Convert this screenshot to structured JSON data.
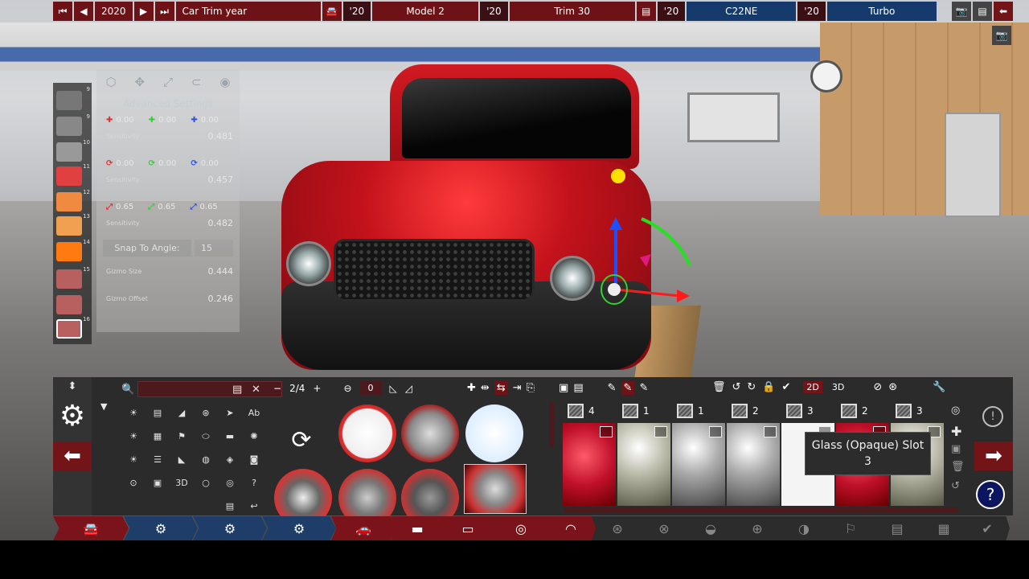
{
  "topbar": {
    "year": "2020",
    "year_label": "Car Trim year",
    "model_year": "'20",
    "model_name": "Model 2",
    "trim_year": "'20",
    "trim_name": "Trim 30",
    "engine_year": "'20",
    "engine_name": "C22NE",
    "variant_year": "'20",
    "variant_name": "Turbo"
  },
  "thumb_numbers": [
    "9",
    "9",
    "10",
    "11",
    "12",
    "13",
    "14",
    "15",
    "16"
  ],
  "advanced": {
    "title": "Advanced Settings",
    "move_x": "0.00",
    "move_y": "0.00",
    "move_z": "0.00",
    "move_sensitivity_label": "Sensitivity",
    "move_sensitivity": "0.481",
    "rot_x": "0.00",
    "rot_y": "0.00",
    "rot_z": "0.00",
    "rot_sensitivity_label": "Sensitivity",
    "rot_sensitivity": "0.457",
    "scale_x": "0.65",
    "scale_y": "0.65",
    "scale_z": "0.65",
    "scale_sensitivity_label": "Sensitivity",
    "scale_sensitivity": "0.482",
    "snap_label": "Snap To Angle:",
    "snap_value": "15",
    "gizmo_size_label": "Gizmo Size",
    "gizmo_size": "0.444",
    "gizmo_offset_label": "Gizmo Offset",
    "gizmo_offset": "0.246"
  },
  "editor": {
    "page_indicator": "2/4",
    "offset_value": "0",
    "btn_2d": "2D",
    "btn_3d": "3D",
    "mat_label_ab": "Ab",
    "mat_label_3d": "3D",
    "slots": [
      "4",
      "1",
      "1",
      "2",
      "3",
      "2",
      "3"
    ]
  },
  "tooltip": {
    "line1": "Glass (Opaque) Slot",
    "line2": "3"
  },
  "colors": {
    "accent_red": "#731419",
    "accent_blue": "#173a6c",
    "panel": "#2b2b2b"
  }
}
